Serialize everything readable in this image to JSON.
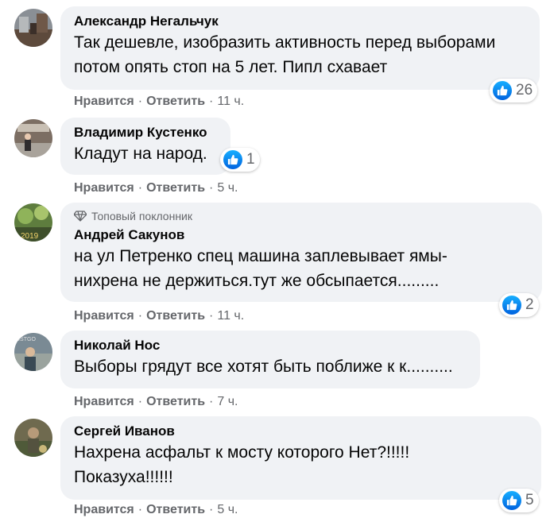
{
  "comments": [
    {
      "author": "Александр Негальчук",
      "lines": [
        "Так дешевле, изобразить активность перед выборами",
        "потом опять стоп на 5 лет. Пипл схавает"
      ],
      "like_label": "Нравится",
      "reply_label": "Ответить",
      "time": "11 ч.",
      "reactions": "26"
    },
    {
      "author": "Владимир Кустенко",
      "lines": [
        "Кладут на народ."
      ],
      "like_label": "Нравится",
      "reply_label": "Ответить",
      "time": "5 ч.",
      "reactions": "1"
    },
    {
      "badge": "Топовый поклонник",
      "author": "Андрей Сакунов",
      "lines": [
        "на ул Петренко спец машина заплевывает ямы-",
        "нихрена не держиться.тут же обсыпается........."
      ],
      "like_label": "Нравится",
      "reply_label": "Ответить",
      "time": "11 ч.",
      "reactions": "2"
    },
    {
      "author": "Николай Нос",
      "lines": [
        "Выборы грядут все хотят быть поближе к к.........."
      ],
      "like_label": "Нравится",
      "reply_label": "Ответить",
      "time": "7 ч."
    },
    {
      "author": "Сергей Иванов",
      "lines": [
        "Нахрена асфальт к мосту которого Нет?!!!!!",
        "Показуха!!!!!!"
      ],
      "like_label": "Нравится",
      "reply_label": "Ответить",
      "time": "5 ч.",
      "reactions": "5"
    }
  ],
  "colors": {
    "bubble": "#f0f2f5",
    "secondary_text": "#65676b",
    "like_blue": "#1877f2"
  },
  "icons": {
    "reaction": "like-thumb-icon",
    "badge": "diamond-icon"
  }
}
